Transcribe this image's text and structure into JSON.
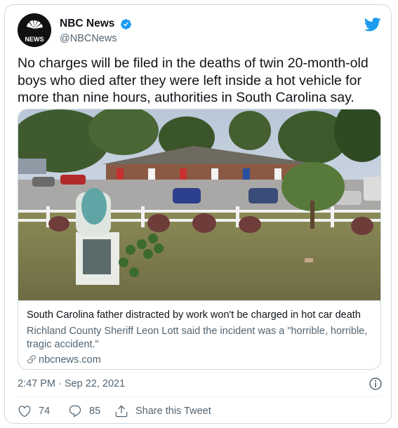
{
  "account": {
    "display_name": "NBC News",
    "handle": "@NBCNews",
    "avatar_text": "NEWS",
    "verified": true
  },
  "tweet": {
    "text": "No charges will be filed in the deaths of twin 20-month-old boys who died after they were left inside a hot vehicle for more than nine hours, authorities in South Carolina say."
  },
  "link_card": {
    "title": "South Carolina father distracted by work won't be charged in hot car death",
    "description": "Richland County Sheriff Leon Lott said the incident was a \"horrible, horrible, tragic accident.\"",
    "domain": "nbcnews.com"
  },
  "meta": {
    "timestamp": "2:47 PM · Sep 22, 2021"
  },
  "actions": {
    "likes": "74",
    "replies": "85",
    "share_label": "Share this Tweet"
  },
  "colors": {
    "twitter_blue": "#1d9bf0",
    "text_primary": "#0f1419",
    "text_secondary": "#536471",
    "border": "#cfd9de"
  },
  "icons": [
    "verified-badge-icon",
    "twitter-bird-icon",
    "link-chain-icon",
    "info-icon",
    "heart-icon",
    "reply-bubble-icon",
    "share-icon",
    "nbc-peacock-logo"
  ]
}
